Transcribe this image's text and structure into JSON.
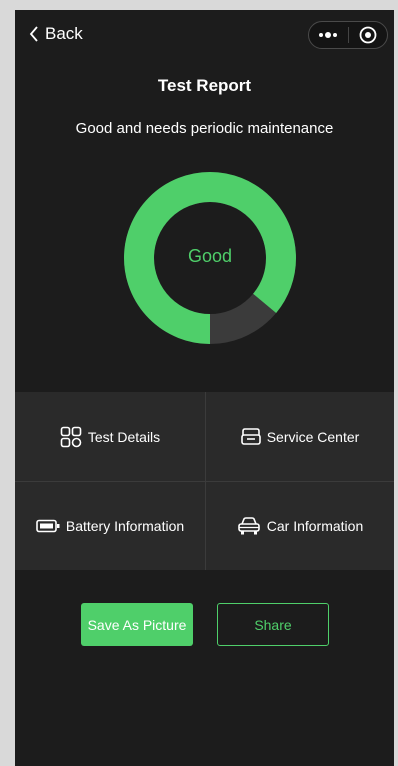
{
  "nav": {
    "back_label": "Back"
  },
  "report": {
    "title": "Test Report",
    "summary": "Good and needs periodic maintenance",
    "status": "Good",
    "good_fraction": 0.86,
    "good_color": "#4fcf6a",
    "rest_color": "#3b3b3b"
  },
  "menu": [
    {
      "label": "Test Details",
      "icon": "grid-icon"
    },
    {
      "label": "Service Center",
      "icon": "service-icon"
    },
    {
      "label": "Battery Information",
      "icon": "battery-icon"
    },
    {
      "label": "Car Information",
      "icon": "car-icon"
    }
  ],
  "actions": {
    "save_label": "Save As Picture",
    "share_label": "Share"
  }
}
